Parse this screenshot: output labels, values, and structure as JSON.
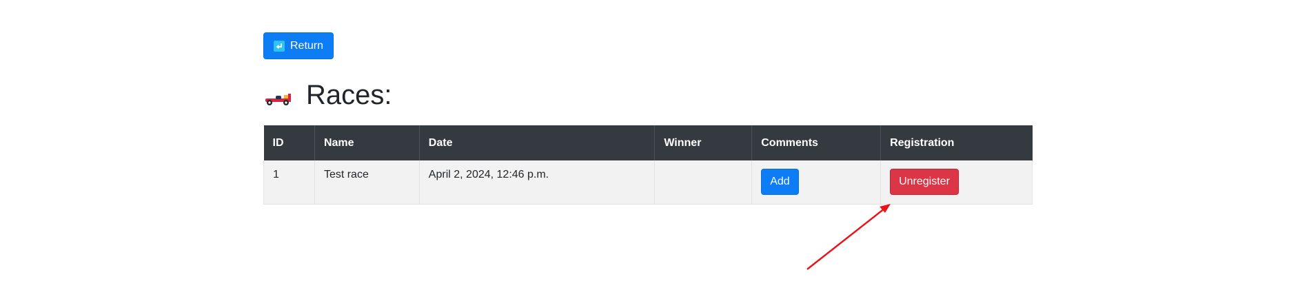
{
  "return_button": {
    "label": "Return",
    "icon": "return-arrow-icon"
  },
  "page": {
    "title": "Races:",
    "icon": "race-car-icon"
  },
  "table": {
    "columns": [
      "ID",
      "Name",
      "Date",
      "Winner",
      "Comments",
      "Registration"
    ],
    "rows": [
      {
        "id": "1",
        "name": "Test race",
        "date": "April 2, 2024, 12:46 p.m.",
        "winner": "",
        "comments_button": "Add",
        "registration_button": "Unregister"
      }
    ]
  },
  "colors": {
    "primary": "#0d7df5",
    "danger": "#dc3545",
    "table_header": "#343a40",
    "row_background": "#f2f2f2",
    "annotation_arrow": "#e8141a"
  }
}
